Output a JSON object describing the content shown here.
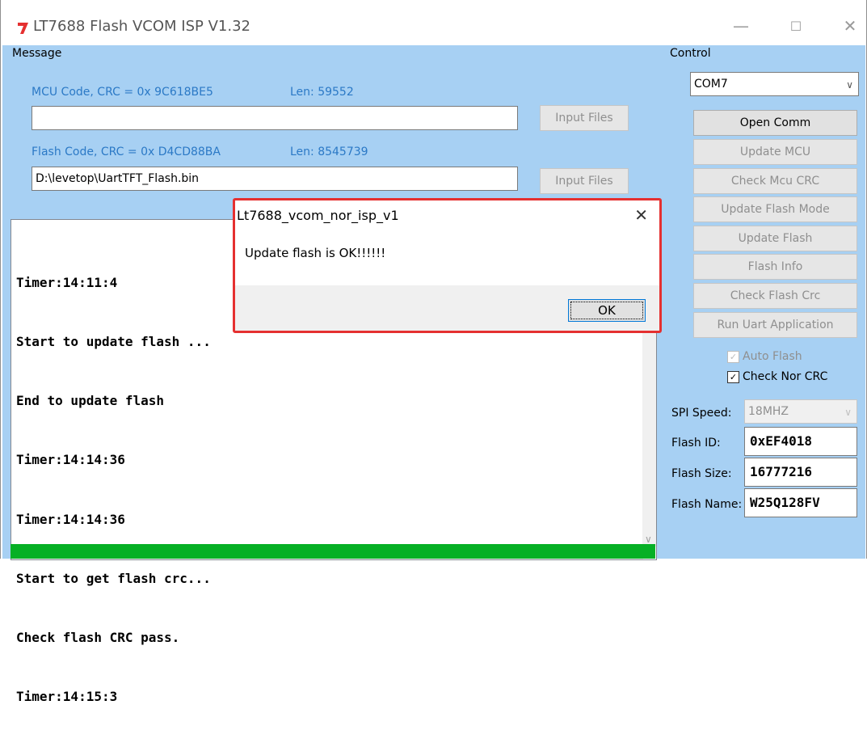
{
  "window": {
    "title": "LT7688 Flash VCOM ISP V1.32",
    "minimize": "—",
    "maximize": "☐",
    "close": "✕"
  },
  "message": {
    "group_label": "Message",
    "mcu_crc_label": "MCU Code, CRC = 0x 9C618BE5",
    "mcu_len_label": "Len:  59552",
    "mcu_path": "",
    "mcu_input_button": "Input Files",
    "flash_crc_label": "Flash Code, CRC = 0x D4CD88BA",
    "flash_len_label": "Len:  8545739",
    "flash_path": "D:\\levetop\\UartTFT_Flash.bin",
    "flash_input_button": "Input Files"
  },
  "log": {
    "lines": [
      "Timer:14:11:4",
      "Start to update flash ...",
      "End to update flash",
      "Timer:14:14:36",
      "Timer:14:14:36",
      "Start to get flash crc...",
      "Check flash CRC pass.",
      "Timer:14:15:3"
    ],
    "hscroll_left": "<",
    "hscroll_right": ">",
    "vscroll_down": "∨"
  },
  "progress": {
    "value": 1.0,
    "color": "#06b025"
  },
  "control": {
    "group_label": "Control",
    "com_port": "COM7",
    "buttons": {
      "open_comm": "Open Comm",
      "update_mcu": "Update MCU",
      "check_mcu_crc": "Check Mcu CRC",
      "update_flash_mode": "Update Flash Mode",
      "update_flash": "Update Flash",
      "flash_info": "Flash Info",
      "check_flash_crc": "Check Flash Crc",
      "run_uart_application": "Run Uart Application"
    },
    "auto_flash": {
      "label": "Auto Flash",
      "checked": true,
      "enabled": false
    },
    "check_nor_crc": {
      "label": "Check Nor CRC",
      "checked": true,
      "enabled": true
    },
    "spi_speed_label": "SPI Speed:",
    "spi_speed_value": "18MHZ",
    "flash_id_label": "Flash ID:",
    "flash_id_value": "0xEF4018",
    "flash_size_label": "Flash Size:",
    "flash_size_value": "16777216",
    "flash_name_label": "Flash Name:",
    "flash_name_value": "W25Q128FV"
  },
  "dialog": {
    "title": "Lt7688_vcom_nor_isp_v1",
    "message": "Update flash is OK!!!!!!",
    "ok_button": "OK",
    "close": "✕"
  },
  "colors": {
    "client_bg": "#a7d0f3",
    "accent_blue": "#2b79c6",
    "highlight_border": "#e53030"
  }
}
